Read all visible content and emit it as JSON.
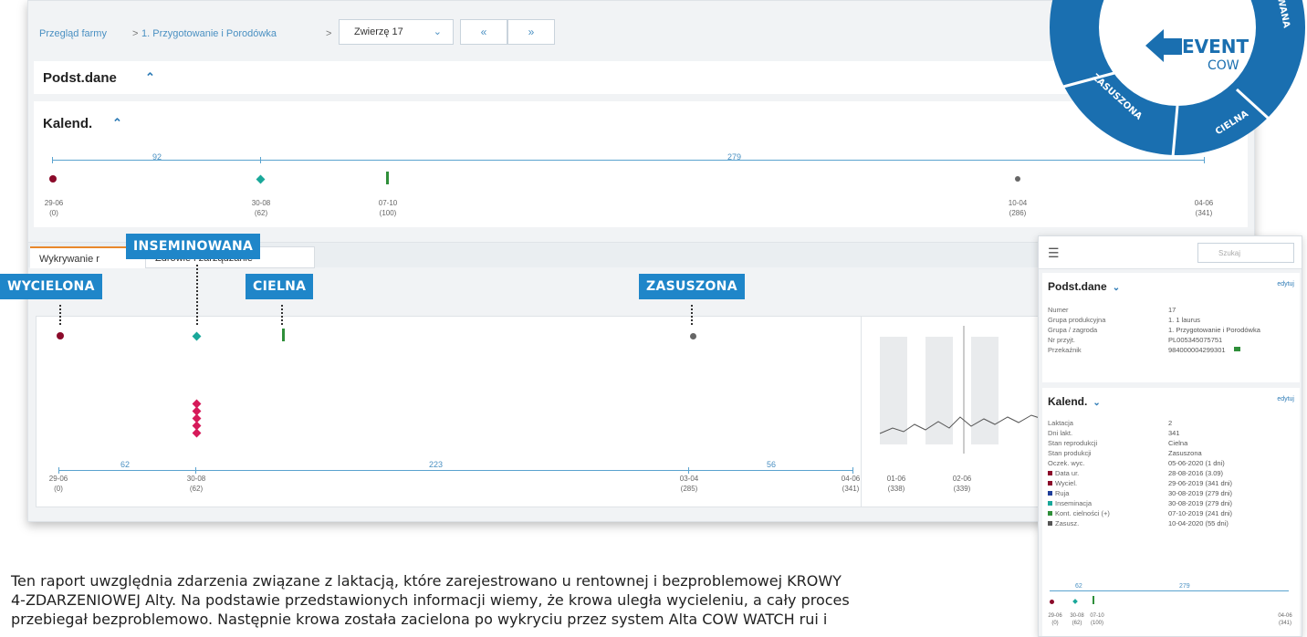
{
  "breadcrumb": {
    "farm": "Przegląd farmy",
    "sep1": ">",
    "group": "1. Przygotowanie i Porodówka",
    "sep2": ">"
  },
  "animal_select": {
    "value": "Zwierzę 17"
  },
  "nav": {
    "prev": "«",
    "next": "»"
  },
  "sections": {
    "basic": "Podst.dane",
    "calendar": "Kalend."
  },
  "top_timeline": {
    "segments": [
      {
        "label": "92"
      },
      {
        "label": "279"
      }
    ],
    "dates": [
      {
        "date": "29-06",
        "days": "(0)"
      },
      {
        "date": "30-08",
        "days": "(62)"
      },
      {
        "date": "07-10",
        "days": "(100)"
      },
      {
        "date": "10-04",
        "days": "(286)"
      },
      {
        "date": "04-06",
        "days": "(341)"
      }
    ]
  },
  "tabs": [
    {
      "label": "Wykrywanie r"
    },
    {
      "label": "Zdrowie i zarządzanie"
    }
  ],
  "tags": {
    "calved": "WYCIELONA",
    "inseminated": "INSEMINOWANA",
    "pregnant": "CIELNA",
    "dried": "ZASUSZONA"
  },
  "bottom_timeline": {
    "segments": [
      {
        "label": "62"
      },
      {
        "label": "223"
      },
      {
        "label": "56"
      }
    ],
    "dates": [
      {
        "date": "29-06",
        "days": "(0)"
      },
      {
        "date": "30-08",
        "days": "(62)"
      },
      {
        "date": "03-04",
        "days": "(285)"
      },
      {
        "date": "04-06",
        "days": "(341)"
      }
    ],
    "chart_dates": [
      {
        "date": "01-06",
        "days": "(338)"
      },
      {
        "date": "02-06",
        "days": "(339)"
      }
    ]
  },
  "logo": {
    "brand_top": "EVENT",
    "brand_bottom": "COW",
    "ring_words": [
      "ZASUSZONA",
      "CIELNA",
      "WANA"
    ],
    "color_dark": "#1a6fb0",
    "color_light": "#ffffff"
  },
  "side": {
    "search_placeholder": "Szukaj",
    "basic_title": "Podst.dane",
    "edit_label": "edytuj",
    "basic_rows": [
      {
        "k": "Numer",
        "v": "17"
      },
      {
        "k": "Grupa produkcyjna",
        "v": "1. 1 laurus"
      },
      {
        "k": "Grupa / zagroda",
        "v": "1. Przygotowanie i Porodówka"
      },
      {
        "k": "Nr przyjt.",
        "v": "PL005345075751"
      },
      {
        "k": "Przekaźnik",
        "v": "984000004299301"
      }
    ],
    "cal_title": "Kalend.",
    "cal_rows": [
      {
        "k": "Laktacja",
        "v": "2",
        "color": ""
      },
      {
        "k": "Dni lakt.",
        "v": "341",
        "color": ""
      },
      {
        "k": "Stan reprodukcji",
        "v": "Cielna",
        "color": ""
      },
      {
        "k": "Stan produkcji",
        "v": "Zasuszona",
        "color": ""
      },
      {
        "k": "Oczek. wyc.",
        "v": "05-06-2020 (1 dni)",
        "color": ""
      },
      {
        "k": "Data ur.",
        "v": "28-08-2016 (3.09)",
        "color": "#8b0a2a"
      },
      {
        "k": "Wyciel.",
        "v": "29-06-2019 (341 dni)",
        "color": "#8b0a2a"
      },
      {
        "k": "Ruja",
        "v": "30-08-2019 (279 dni)",
        "color": "#1f3f9a"
      },
      {
        "k": "Inseminacja",
        "v": "30-08-2019 (279 dni)",
        "color": "#1aa89a"
      },
      {
        "k": "Kont. cielności (+)",
        "v": "07-10-2019 (241 dni)",
        "color": "#2f8f3a"
      },
      {
        "k": "Zasusz.",
        "v": "10-04-2020 (55 dni)",
        "color": "#555555"
      }
    ],
    "mini_segments": [
      {
        "label": "62"
      },
      {
        "label": "279"
      }
    ],
    "mini_dates": [
      {
        "date": "29-06",
        "days": "(0)"
      },
      {
        "date": "30-08",
        "days": "(62)"
      },
      {
        "date": "07-10",
        "days": "(100)"
      },
      {
        "date": "04-06",
        "days": "(341)"
      }
    ]
  },
  "body_text": {
    "line1": "Ten raport uwzględnia zdarzenia związane z laktacją, które zarejestrowano u rentownej i bezproblemowej KROWY",
    "line2": "4-ZDARZENIOWEJ Alty. Na podstawie przedstawionych informacji wiemy, że krowa uległa wycieleniu, a cały proces",
    "line3": "przebiegał bezproblemowo. Następnie krowa została zacielona po wykryciu przez system Alta COW WATCH rui i"
  },
  "colors": {
    "calving": "#8b0a2a",
    "insemination": "#1aa89a",
    "heat": "#d61a5a",
    "pregnancy": "#2f8f3a",
    "dry": "#666666",
    "accent": "#1f86c9"
  }
}
